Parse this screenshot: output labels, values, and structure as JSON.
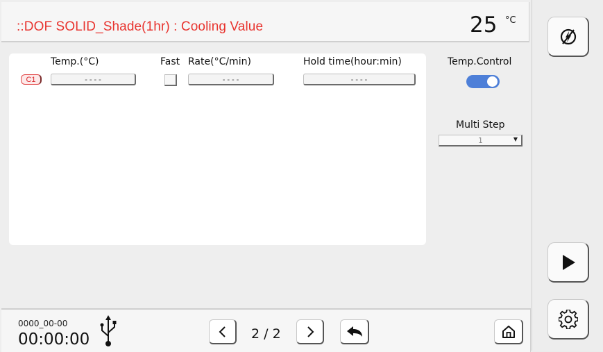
{
  "header": {
    "title": "::DOF SOLID_Shade(1hr) : Cooling Value",
    "temperature": "25",
    "temperature_unit": "°C"
  },
  "table": {
    "headers": {
      "temp": "Temp.(°C)",
      "fast": "Fast",
      "rate": "Rate(°C/min)",
      "hold": "Hold time(hour:min)"
    },
    "rows": [
      {
        "channel": "C1",
        "temp": "----",
        "rate": "----",
        "hold": "----",
        "fast": false
      }
    ]
  },
  "side": {
    "temp_control_label": "Temp.Control",
    "temp_control_on": true,
    "multi_step_label": "Multi Step",
    "multi_step_value": "1"
  },
  "footer": {
    "date": "0000_00-00",
    "time": "00:00:00",
    "page": "2 / 2"
  },
  "icons": {
    "power": "power-slash-icon",
    "play": "play-icon",
    "settings": "gear-icon",
    "home": "home-icon",
    "back": "back-arrow-icon",
    "usb": "usb-icon"
  },
  "colors": {
    "title": "#e8342f",
    "toggle": "#4d7fd8",
    "chip": "#d8262a"
  }
}
